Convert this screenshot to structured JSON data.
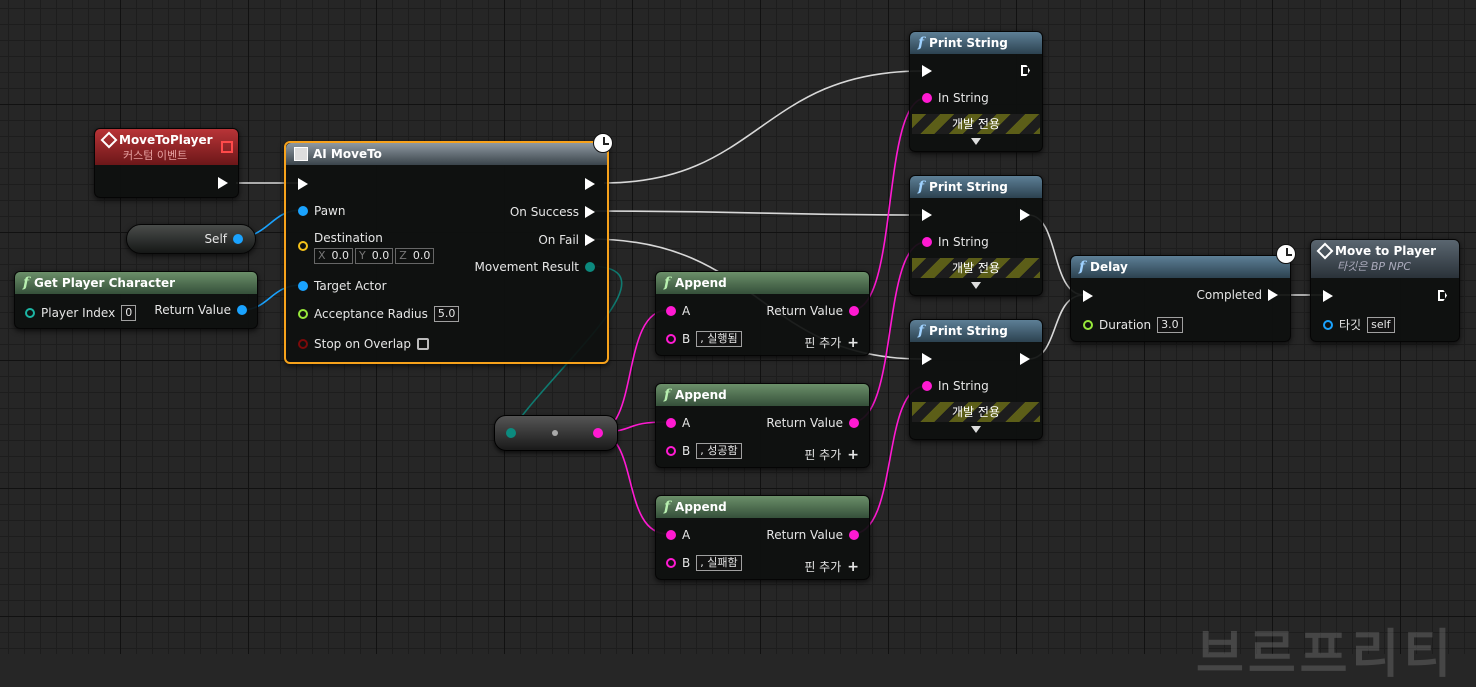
{
  "colors": {
    "exec": "#ffffff",
    "object": "#1aa3ff",
    "string": "#ff1ad2",
    "vector": "#f5c21a",
    "float": "#97e83b",
    "bool": "#7c0a0a",
    "enum": "#1cb5a4",
    "selection": "#f7a21b"
  },
  "event": {
    "title": "MoveToPlayer",
    "subtitle": "커스텀 이벤트",
    "icon": "event-icon"
  },
  "self_node": {
    "label": "Self"
  },
  "get_player": {
    "title": "Get Player Character",
    "player_index_label": "Player Index",
    "player_index_value": "0",
    "return_label": "Return Value"
  },
  "ai_move": {
    "title": "AI MoveTo",
    "pawn": "Pawn",
    "destination": "Destination",
    "dest_x_axis": "X",
    "dest_x": "0.0",
    "dest_y_axis": "Y",
    "dest_y": "0.0",
    "dest_z_axis": "Z",
    "dest_z": "0.0",
    "target_actor": "Target Actor",
    "acceptance_radius": "Acceptance Radius",
    "acceptance_value": "5.0",
    "stop_on_overlap": "Stop on Overlap",
    "on_success": "On Success",
    "on_fail": "On Fail",
    "movement_result": "Movement Result"
  },
  "appends": [
    {
      "title": "Append",
      "a": "A",
      "b": "B",
      "b_value": ", 실행됨",
      "return": "Return Value",
      "add_pin": "핀 추가"
    },
    {
      "title": "Append",
      "a": "A",
      "b": "B",
      "b_value": ", 성공함",
      "return": "Return Value",
      "add_pin": "핀 추가"
    },
    {
      "title": "Append",
      "a": "A",
      "b": "B",
      "b_value": ", 실패함",
      "return": "Return Value",
      "add_pin": "핀 추가"
    }
  ],
  "prints": [
    {
      "title": "Print String",
      "in_string": "In String",
      "dev_only": "개발 전용"
    },
    {
      "title": "Print String",
      "in_string": "In String",
      "dev_only": "개발 전용"
    },
    {
      "title": "Print String",
      "in_string": "In String",
      "dev_only": "개발 전용"
    }
  ],
  "delay": {
    "title": "Delay",
    "completed": "Completed",
    "duration_label": "Duration",
    "duration_value": "3.0"
  },
  "move_to_player": {
    "title": "Move to Player",
    "subtitle": "타깃은 BP NPC",
    "target_label": "타깃",
    "target_value": "self"
  },
  "watermark": "브르프리티"
}
